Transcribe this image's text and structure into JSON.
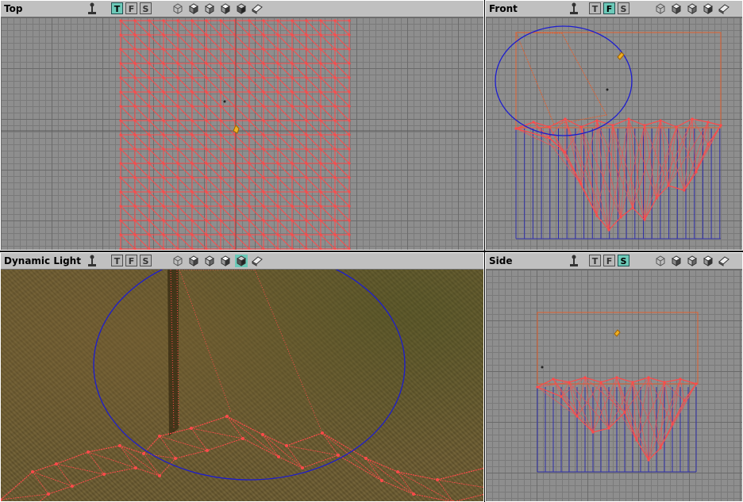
{
  "viewports": {
    "top": {
      "title": "Top",
      "active_view": "T"
    },
    "front": {
      "title": "Front",
      "active_view": "F"
    },
    "persp": {
      "title": "Dynamic Light",
      "active_view": ""
    },
    "side": {
      "title": "Side",
      "active_view": "S"
    }
  },
  "view_buttons": {
    "t": "T",
    "f": "F",
    "s": "S"
  },
  "render_mode_icons": [
    "wireframe-cube-icon",
    "solid-cube-icon",
    "textured-cube-icon",
    "lit-cube-icon",
    "dynamic-light-cube-icon",
    "book-icon"
  ],
  "colors": {
    "grid_bg": "#8e8e8e",
    "mesh": "#ff4a4a",
    "brush": "#2f2fa8",
    "selection_circle": "#1c1cd0",
    "bounds": "#e06030",
    "active_button": "#6cc9b8"
  }
}
